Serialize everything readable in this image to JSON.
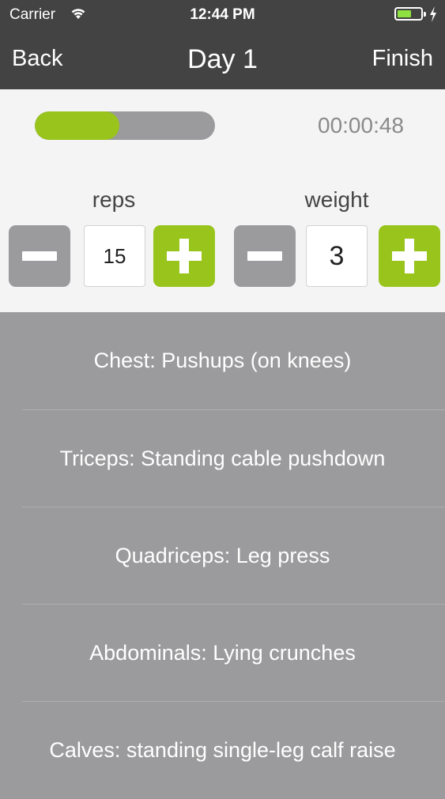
{
  "status_bar": {
    "carrier": "Carrier",
    "time": "12:44 PM",
    "wifi_icon": "wifi-icon",
    "battery_icon": "battery-icon",
    "charging_icon": "bolt-icon",
    "battery_level": 0.6
  },
  "nav": {
    "back_label": "Back",
    "title": "Day 1",
    "finish_label": "Finish"
  },
  "session": {
    "progress": 0.47,
    "timer": "00:00:48"
  },
  "reps": {
    "label": "reps",
    "value": "15",
    "decrement_icon": "minus-icon",
    "increment_icon": "plus-icon"
  },
  "weight": {
    "label": "weight",
    "value": "3",
    "decrement_icon": "minus-icon",
    "increment_icon": "plus-icon"
  },
  "exercises": [
    "Chest: Pushups (on knees)",
    "Triceps: Standing cable pushdown",
    "Quadriceps: Leg press",
    "Abdominals: Lying crunches",
    "Calves: standing single-leg calf raise"
  ],
  "colors": {
    "nav_bg": "#434343",
    "accent_green": "#98c41c",
    "neutral_gray": "#9b9a9c",
    "panel_bg": "#f4f4f4"
  }
}
